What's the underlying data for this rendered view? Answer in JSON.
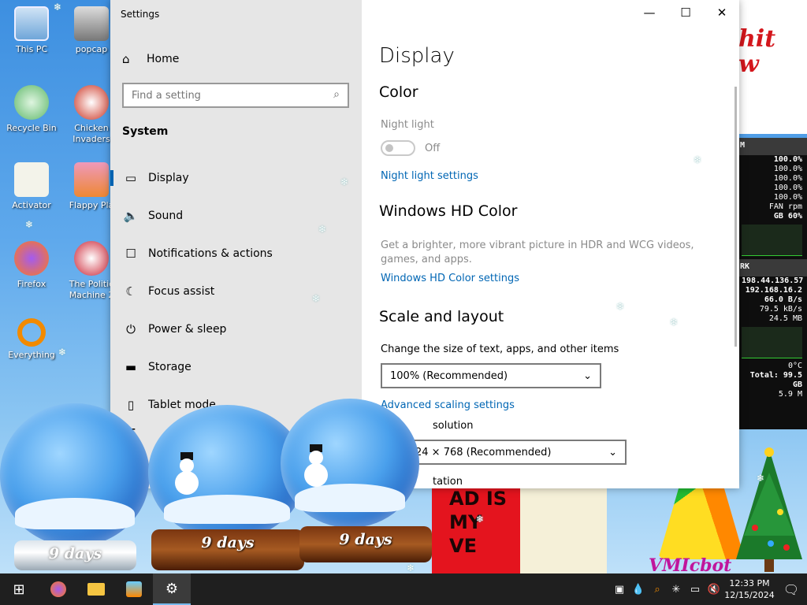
{
  "desktop": {
    "icons": [
      {
        "label": "This PC"
      },
      {
        "label": "popcap"
      },
      {
        "label": "Recycle Bin"
      },
      {
        "label": "Chicken Invaders"
      },
      {
        "label": "Activator"
      },
      {
        "label": "Flappy Pla"
      },
      {
        "label": "Firefox"
      },
      {
        "label": "The Politic Machine 2"
      },
      {
        "label": "Everything"
      }
    ],
    "bubble_text": "hit\nw",
    "poster_text": "AD IS\nMY\nVE",
    "art_text": "VMIcbot"
  },
  "monitor": {
    "cpu_header": "M",
    "cpu_values": [
      "100.0%",
      "100.0%",
      "100.0%",
      "100.0%",
      "100.0%"
    ],
    "fan": "FAN  rpm",
    "mem": "GB     60%",
    "net_header": "RK",
    "ip1": "198.44.136.57",
    "ip2": "192.168.16.2",
    "rate1": "66.0 B/s",
    "rate2": "79.5 kB/s",
    "rate3": "24.5 MB",
    "temp": "0°C",
    "total": "Total: 99.5 GB",
    "small": "5.9 M"
  },
  "window": {
    "title": "Settings",
    "home": "Home",
    "search_placeholder": "Find a setting",
    "section": "System",
    "nav_items": [
      {
        "label": "Display",
        "icon": "monitor-icon"
      },
      {
        "label": "Sound",
        "icon": "speaker-icon"
      },
      {
        "label": "Notifications & actions",
        "icon": "message-icon"
      },
      {
        "label": "Focus assist",
        "icon": "moon-icon"
      },
      {
        "label": "Power & sleep",
        "icon": "power-icon"
      },
      {
        "label": "Storage",
        "icon": "storage-icon"
      },
      {
        "label": "Tablet mode",
        "icon": "tablet-icon"
      },
      {
        "label": "",
        "icon": "multitasking-icon"
      }
    ],
    "content": {
      "page_title": "Display",
      "color_heading": "Color",
      "night_light_label": "Night light",
      "night_light_state": "Off",
      "night_light_link": "Night light settings",
      "hd_heading": "Windows HD Color",
      "hd_desc": "Get a brighter, more vibrant picture in HDR and WCG videos, games, and apps.",
      "hd_link": "Windows HD Color settings",
      "scale_heading": "Scale and layout",
      "scale_label": "Change the size of text, apps, and other items",
      "scale_value": "100% (Recommended)",
      "adv_link": "Advanced scaling settings",
      "res_label": "solution",
      "res_value": "24 × 768 (Recommended)",
      "orientation_label": "tation"
    }
  },
  "globes": [
    {
      "label": "9 days"
    },
    {
      "label": "9 days"
    },
    {
      "label": "9 days"
    }
  ],
  "taskbar": {
    "time": "12:33 PM",
    "date": "12/15/2024"
  }
}
